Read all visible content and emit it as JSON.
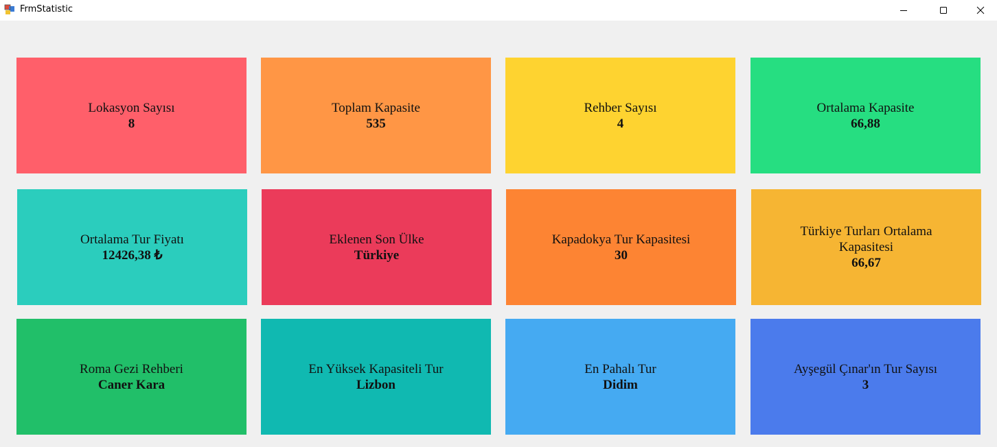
{
  "window": {
    "title": "FrmStatistic",
    "controls": {
      "minimize": "minimize-icon",
      "maximize": "maximize-icon",
      "close": "close-icon"
    }
  },
  "tiles": [
    {
      "label": "Lokasyon Sayısı",
      "value": "8",
      "color": "#ff5f6a"
    },
    {
      "label": "Toplam Kapasite",
      "value": "535",
      "color": "#ff9645"
    },
    {
      "label": "Rehber Sayısı",
      "value": "4",
      "color": "#fed330"
    },
    {
      "label": "Ortalama Kapasite",
      "value": "66,88",
      "color": "#26de81"
    },
    {
      "label": "Ortalama Tur Fiyatı",
      "value": "12426,38 ₺",
      "color": "#2bcdbd"
    },
    {
      "label": "Eklenen Son Ülke",
      "value": "Türkiye",
      "color": "#eb3b5a"
    },
    {
      "label": "Kapadokya Tur Kapasitesi",
      "value": "30",
      "color": "#fd8433"
    },
    {
      "label": "Türkiye Turları Ortalama Kapasitesi",
      "value": "66,67",
      "color": "#f6b533"
    },
    {
      "label": "Roma Gezi Rehberi",
      "value": "Caner Kara",
      "color": "#21bf69"
    },
    {
      "label": "En Yüksek Kapasiteli Tur",
      "value": "Lizbon",
      "color": "#10b9b1"
    },
    {
      "label": "En Pahalı Tur",
      "value": "Didim",
      "color": "#45aaf2"
    },
    {
      "label": "Ayşegül Çınar'ın Tur Sayısı",
      "value": "3",
      "color": "#4b7bec"
    }
  ]
}
